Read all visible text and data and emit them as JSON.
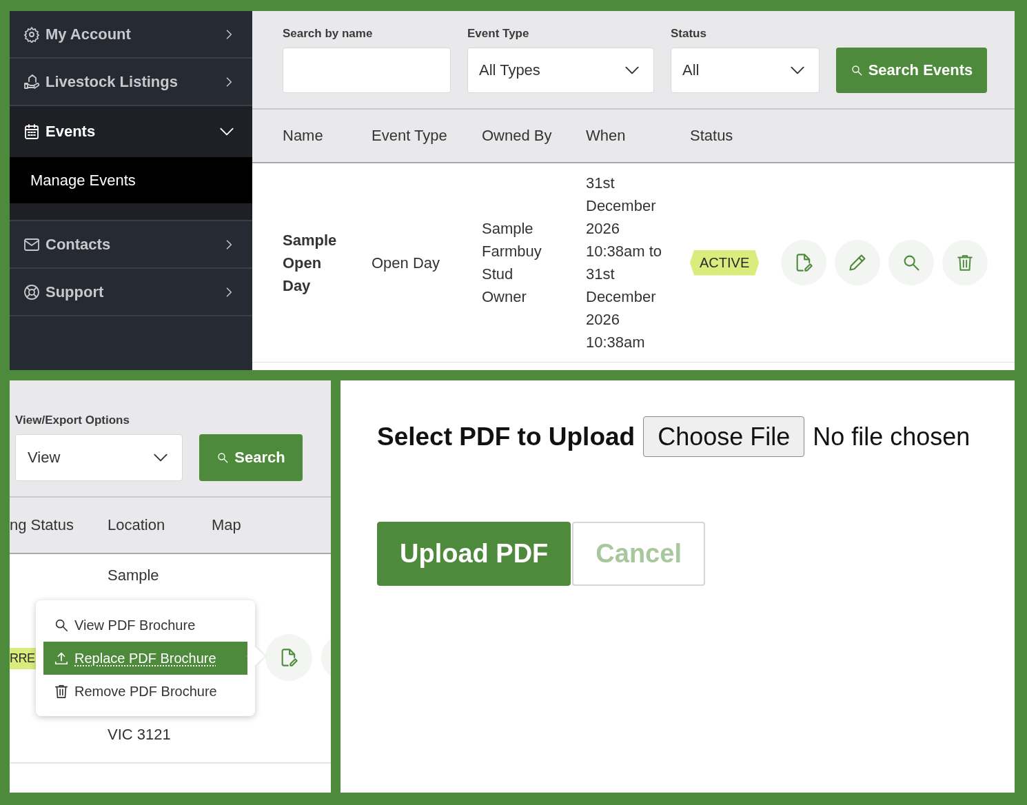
{
  "events_screen": {
    "sidebar": {
      "items": [
        {
          "label": "My Account",
          "expanded": false
        },
        {
          "label": "Livestock Listings",
          "expanded": false
        },
        {
          "label": "Events",
          "expanded": true,
          "children": [
            {
              "label": "Manage Events",
              "selected": true
            }
          ]
        },
        {
          "label": "Contacts",
          "expanded": false
        },
        {
          "label": "Support",
          "expanded": false
        }
      ]
    },
    "filters": [
      {
        "kind": "text",
        "label": "Search by name"
      },
      {
        "kind": "select",
        "label": "Event Type",
        "value": "All Types"
      },
      {
        "kind": "select",
        "label": "Status",
        "value": "All"
      }
    ],
    "search_button": "Search Events",
    "table": {
      "columns": [
        "Name",
        "Event Type",
        "Owned By",
        "When",
        "Status"
      ],
      "rows": [
        {
          "name": "Sample Open Day",
          "event_type": "Open Day",
          "owned_by": "Sample Farmbuy Stud Owner",
          "when": "31st December 2026 10:38am to 31st December 2026 10:38am",
          "status": "ACTIVE"
        }
      ]
    }
  },
  "listings_screen": {
    "filter": {
      "label": "View/Export Options",
      "value": "View"
    },
    "search_button": "Search",
    "table": {
      "columns": [
        "ng Status",
        "Location",
        "Map"
      ],
      "row": {
        "status": "RRE",
        "location_top": [
          "Sample"
        ],
        "location_bottom": [
          "VIC 3121"
        ]
      }
    },
    "menu": [
      {
        "label": "View PDF Brochure",
        "selected": false
      },
      {
        "label": "Replace PDF Brochure",
        "selected": true
      },
      {
        "label": "Remove PDF Brochure",
        "selected": false
      }
    ]
  },
  "upload_screen": {
    "label": "Select PDF to Upload",
    "file_button": "Choose File",
    "file_status": "No file chosen",
    "buttons": [
      {
        "label": "Upload PDF",
        "kind": "primary"
      },
      {
        "label": "Cancel",
        "kind": "secondary"
      }
    ]
  }
}
